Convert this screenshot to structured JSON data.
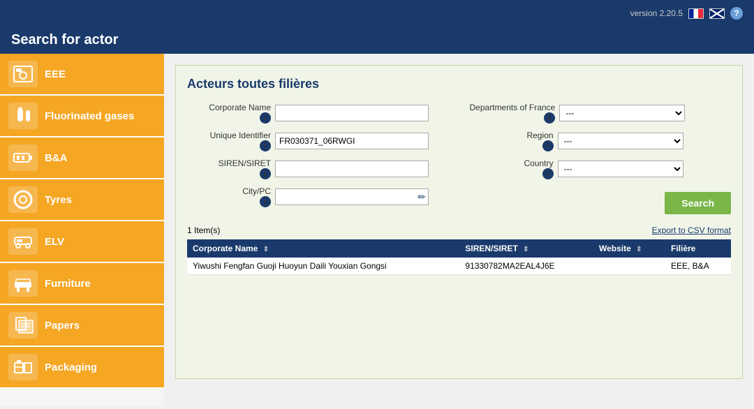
{
  "header": {
    "version": "version 2.20.5",
    "title": "Search for actor",
    "help_label": "?"
  },
  "sidebar": {
    "items": [
      {
        "id": "eee",
        "label": "EEE",
        "icon": "washing-machine"
      },
      {
        "id": "fluorinated-gases",
        "label": "Fluorinated gases",
        "icon": "gas-cylinder"
      },
      {
        "id": "bna",
        "label": "B&A",
        "icon": "battery"
      },
      {
        "id": "tyres",
        "label": "Tyres",
        "icon": "tyre"
      },
      {
        "id": "elv",
        "label": "ELV",
        "icon": "car-seat"
      },
      {
        "id": "furniture",
        "label": "Furniture",
        "icon": "furniture"
      },
      {
        "id": "papers",
        "label": "Papers",
        "icon": "papers"
      },
      {
        "id": "packaging",
        "label": "Packaging",
        "icon": "packaging"
      }
    ]
  },
  "panel": {
    "title": "Acteurs toutes filières",
    "form": {
      "corporate_name_label": "Corporate Name",
      "unique_identifier_label": "Unique Identifier",
      "siren_siret_label": "SIREN/SIRET",
      "city_pc_label": "City/PC",
      "departments_france_label": "Departments of France",
      "region_label": "Region",
      "country_label": "Country",
      "corporate_name_value": "",
      "unique_identifier_value": "FR030371_06RWGI",
      "siren_siret_value": "",
      "city_pc_value": "",
      "departments_france_value": "---",
      "region_value": "---",
      "country_value": "---",
      "departments_options": [
        "---"
      ],
      "region_options": [
        "---"
      ],
      "country_options": [
        "---"
      ]
    },
    "search_button": "Search",
    "items_count": "1 Item(s)",
    "export_link": "Export to CSV format"
  },
  "table": {
    "columns": [
      {
        "id": "corporate_name",
        "label": "Corporate Name"
      },
      {
        "id": "siren_siret",
        "label": "SIREN/SIRET"
      },
      {
        "id": "website",
        "label": "Website"
      },
      {
        "id": "filiere",
        "label": "Filière"
      }
    ],
    "rows": [
      {
        "corporate_name": "Yiwushi Fengfan Guoji Huoyun Daili Youxian Gongsi",
        "siren_siret": "91330782MA2EAL4J6E",
        "website": "",
        "filiere": "EEE, B&A"
      }
    ]
  }
}
